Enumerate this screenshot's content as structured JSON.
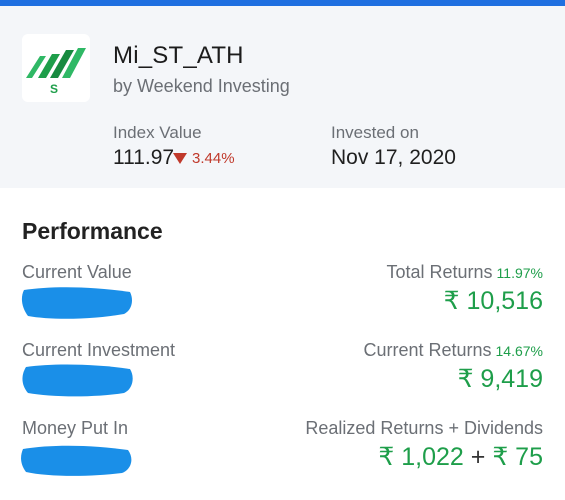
{
  "header": {
    "title": "Mi_ST_ATH",
    "subtitle": "by Weekend Investing",
    "logo_letter": "S",
    "index_label": "Index Value",
    "index_value": "111.97",
    "index_change": "3.44%",
    "invested_label": "Invested on",
    "invested_date": "Nov 17, 2020"
  },
  "performance": {
    "title": "Performance",
    "rows": [
      {
        "left_label": "Current Value",
        "right_label": "Total Returns",
        "right_pct": "11.97%",
        "amount_parts": [
          "₹ 10,516"
        ]
      },
      {
        "left_label": "Current Investment",
        "right_label": "Current Returns",
        "right_pct": "14.67%",
        "amount_parts": [
          "₹ 9,419"
        ]
      },
      {
        "left_label": "Money Put In",
        "right_label": "Realized Returns + Dividends",
        "right_pct": "",
        "amount_parts": [
          "₹ 1,022",
          "+",
          "₹ 75"
        ]
      }
    ]
  },
  "colors": {
    "accent_bar": "#1f6fe0",
    "positive": "#1e9e4a",
    "negative": "#c0392b",
    "redaction": "#1a8fe8"
  },
  "icons": {
    "logo": "smallcase-logo-icon",
    "change": "triangle-down-icon"
  }
}
